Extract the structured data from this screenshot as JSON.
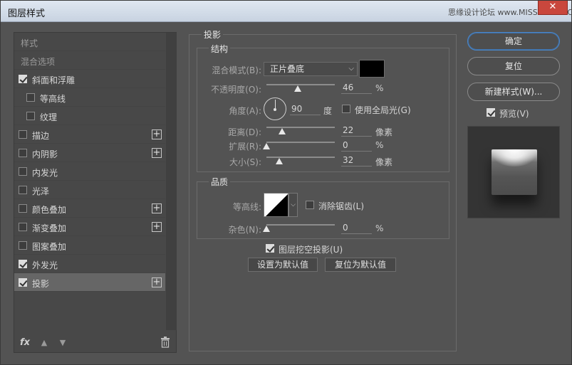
{
  "window": {
    "title": "图层样式",
    "watermark": "思缘设计论坛 www.MISSYUAN.COM",
    "close": "✕"
  },
  "left": {
    "items": [
      {
        "label": "样式",
        "type": "head"
      },
      {
        "label": "混合选项",
        "type": "head"
      },
      {
        "label": "斜面和浮雕",
        "checked": true,
        "indent": 0,
        "plus": false
      },
      {
        "label": "等高线",
        "checked": false,
        "indent": 1,
        "plus": false
      },
      {
        "label": "纹理",
        "checked": false,
        "indent": 1,
        "plus": false
      },
      {
        "label": "描边",
        "checked": false,
        "indent": 0,
        "plus": true
      },
      {
        "label": "内阴影",
        "checked": false,
        "indent": 0,
        "plus": true
      },
      {
        "label": "内发光",
        "checked": false,
        "indent": 0,
        "plus": false
      },
      {
        "label": "光泽",
        "checked": false,
        "indent": 0,
        "plus": false
      },
      {
        "label": "颜色叠加",
        "checked": false,
        "indent": 0,
        "plus": true
      },
      {
        "label": "渐变叠加",
        "checked": false,
        "indent": 0,
        "plus": true
      },
      {
        "label": "图案叠加",
        "checked": false,
        "indent": 0,
        "plus": false
      },
      {
        "label": "外发光",
        "checked": true,
        "indent": 0,
        "plus": false
      },
      {
        "label": "投影",
        "checked": true,
        "indent": 0,
        "plus": true,
        "selected": true
      }
    ],
    "footer": {
      "fx": "fx"
    }
  },
  "dropshadow": {
    "section_title": "投影",
    "structure_title": "结构",
    "blend_mode_label": "混合模式(B):",
    "blend_mode_value": "正片叠底",
    "shadow_color": "#000000",
    "opacity_label": "不透明度(O):",
    "opacity_value": "46",
    "opacity_unit": "%",
    "opacity_fraction": 0.46,
    "angle_label": "角度(A):",
    "angle_value": "90",
    "angle_unit": "度",
    "global_light_label": "使用全局光(G)",
    "global_light_checked": false,
    "distance_label": "距离(D):",
    "distance_value": "22",
    "distance_unit": "像素",
    "spread_label": "扩展(R):",
    "spread_value": "0",
    "spread_unit": "%",
    "size_label": "大小(S):",
    "size_value": "32",
    "size_unit": "像素",
    "quality_title": "品质",
    "contour_label": "等高线:",
    "antialias_label": "消除锯齿(L)",
    "antialias_checked": false,
    "noise_label": "杂色(N):",
    "noise_value": "0",
    "noise_unit": "%",
    "knockout_label": "图层挖空投影(U)",
    "knockout_checked": true,
    "make_default": "设置为默认值",
    "reset_default": "复位为默认值"
  },
  "right": {
    "ok": "确定",
    "reset": "复位",
    "new_style": "新建样式(W)...",
    "preview_label": "预览(V)",
    "preview_checked": true
  }
}
